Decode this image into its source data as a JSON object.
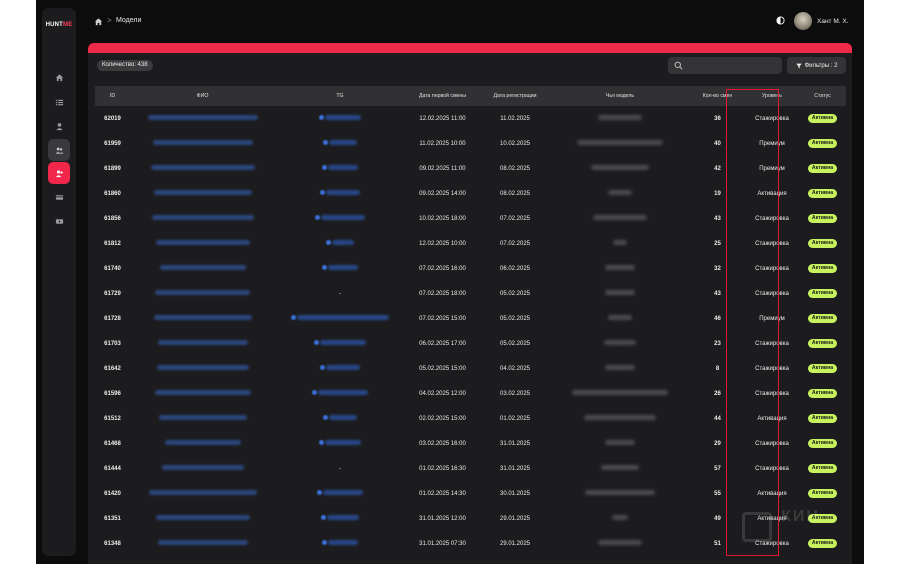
{
  "app": {
    "logo_main": "HUNT",
    "logo_accent": "ME"
  },
  "breadcrumb": {
    "separator": ">",
    "page": "Модели"
  },
  "user": {
    "name": "Хант М. Х."
  },
  "toolbar": {
    "count_label": "Количество: 438",
    "search_placeholder": "",
    "filters_label": "Фильтры : 2"
  },
  "table": {
    "headers": {
      "id": "ID",
      "fio": "ФИО",
      "tg": "TG",
      "first_shift": "Дата первой смены",
      "registration": "Дата регистрации",
      "owner_model": "Чья модель",
      "shift_count": "Кол-во смен",
      "level": "Уровень",
      "status": "Статус"
    },
    "rows": [
      {
        "id": "62019",
        "tg": "",
        "first_shift": "12.02.2025 11:00",
        "registration": "11.02.2025",
        "shifts": "36",
        "level": "Стажировка",
        "status": "Активна"
      },
      {
        "id": "61959",
        "tg": "",
        "first_shift": "11.02.2025 10:00",
        "registration": "10.02.2025",
        "shifts": "40",
        "level": "Премиум",
        "status": "Активна"
      },
      {
        "id": "61899",
        "tg": "",
        "first_shift": "09.02.2025 11:00",
        "registration": "08.02.2025",
        "shifts": "42",
        "level": "Премиум",
        "status": "Активна"
      },
      {
        "id": "61860",
        "tg": "",
        "first_shift": "09.02.2025 14:00",
        "registration": "08.02.2025",
        "shifts": "19",
        "level": "Активация",
        "status": "Активна"
      },
      {
        "id": "61856",
        "tg": "",
        "first_shift": "10.02.2025 18:00",
        "registration": "07.02.2025",
        "shifts": "43",
        "level": "Стажировка",
        "status": "Активна"
      },
      {
        "id": "61812",
        "tg": "",
        "first_shift": "12.02.2025 10:00",
        "registration": "07.02.2025",
        "shifts": "25",
        "level": "Стажировка",
        "status": "Активна"
      },
      {
        "id": "61740",
        "tg": "",
        "first_shift": "07.02.2025 16:00",
        "registration": "06.02.2025",
        "shifts": "32",
        "level": "Стажировка",
        "status": "Активна"
      },
      {
        "id": "61729",
        "tg": "-",
        "first_shift": "07.02.2025 18:00",
        "registration": "05.02.2025",
        "shifts": "43",
        "level": "Стажировка",
        "status": "Активна"
      },
      {
        "id": "61728",
        "tg": "",
        "first_shift": "07.02.2025 15:00",
        "registration": "05.02.2025",
        "shifts": "46",
        "level": "Премиум",
        "status": "Активна"
      },
      {
        "id": "61703",
        "tg": "",
        "first_shift": "06.02.2025 17:00",
        "registration": "05.02.2025",
        "shifts": "23",
        "level": "Стажировка",
        "status": "Активна"
      },
      {
        "id": "61642",
        "tg": "",
        "first_shift": "05.02.2025 15:00",
        "registration": "04.02.2025",
        "shifts": "8",
        "level": "Стажировка",
        "status": "Активна"
      },
      {
        "id": "61596",
        "tg": "",
        "first_shift": "04.02.2025 12:00",
        "registration": "03.02.2025",
        "shifts": "26",
        "level": "Стажировка",
        "status": "Активна"
      },
      {
        "id": "61512",
        "tg": "",
        "first_shift": "02.02.2025 15:00",
        "registration": "01.02.2025",
        "shifts": "44",
        "level": "Активация",
        "status": "Активна"
      },
      {
        "id": "61468",
        "tg": "",
        "first_shift": "03.02.2025 16:00",
        "registration": "31.01.2025",
        "shifts": "29",
        "level": "Стажировка",
        "status": "Активна"
      },
      {
        "id": "61444",
        "tg": "-",
        "first_shift": "01.02.2025 16:30",
        "registration": "31.01.2025",
        "shifts": "57",
        "level": "Стажировка",
        "status": "Активна"
      },
      {
        "id": "61420",
        "tg": "",
        "first_shift": "01.02.2025 14:30",
        "registration": "30.01.2025",
        "shifts": "55",
        "level": "Активация",
        "status": "Активна"
      },
      {
        "id": "61351",
        "tg": "",
        "first_shift": "31.01.2025 12:00",
        "registration": "29.01.2025",
        "shifts": "49",
        "level": "Активация",
        "status": "Активна"
      },
      {
        "id": "61348",
        "tg": "",
        "first_shift": "31.01.2025 07:30",
        "registration": "29.01.2025",
        "shifts": "51",
        "level": "Стажировка",
        "status": "Активна"
      }
    ]
  },
  "colors": {
    "accent": "#ee2a48",
    "status_active": "#c7f25e",
    "highlight_box": "#e0182f"
  }
}
